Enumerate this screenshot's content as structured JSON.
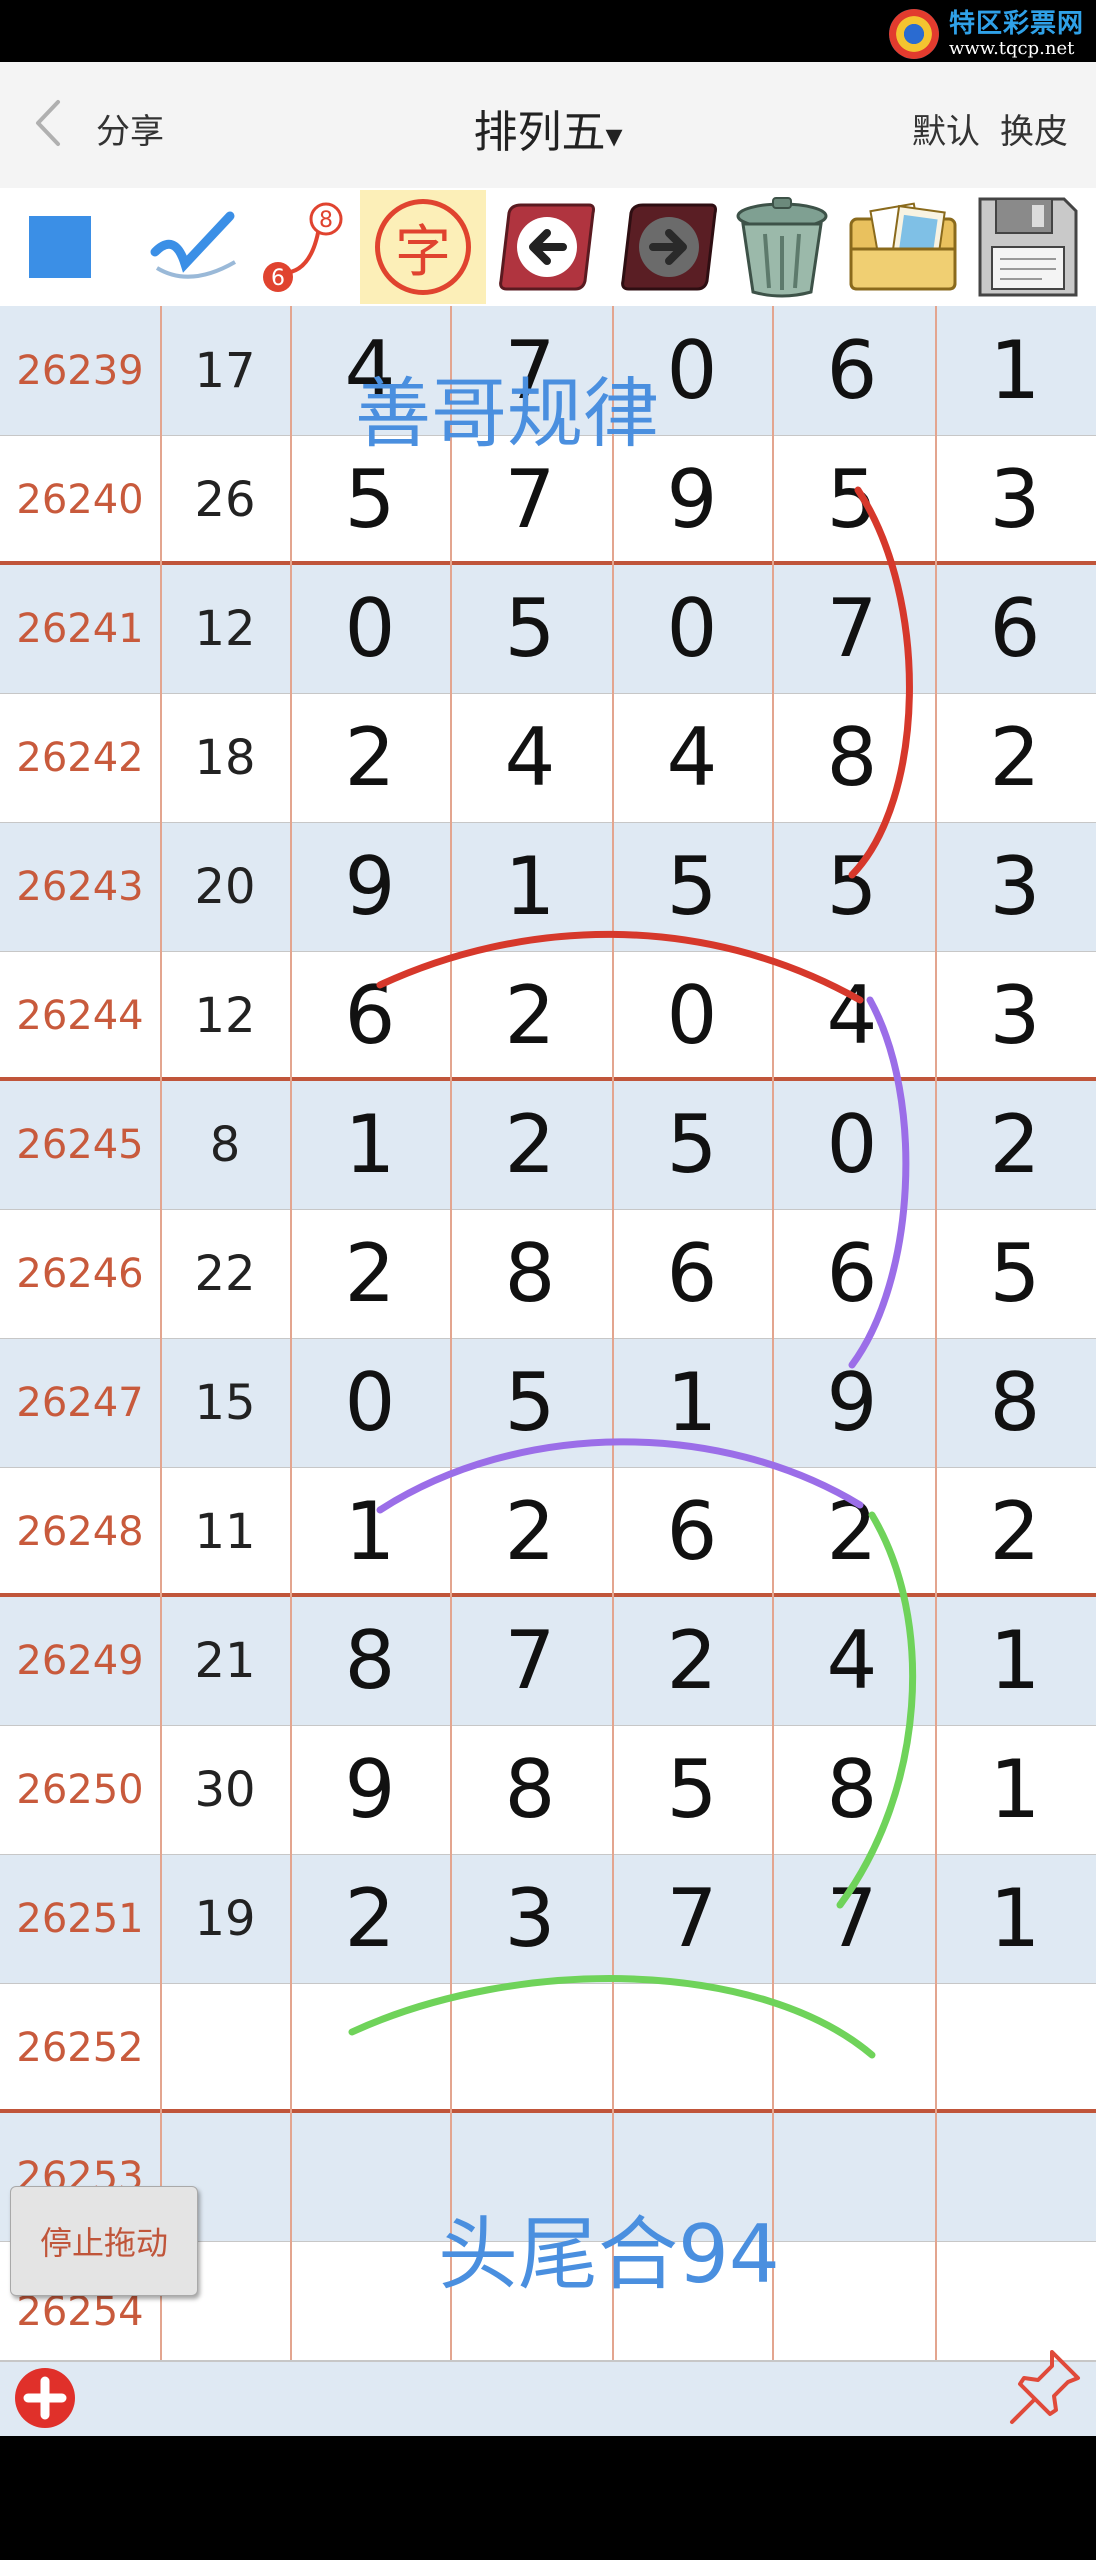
{
  "watermark": {
    "title": "特区彩票网",
    "url": "www.tqcp.net"
  },
  "header": {
    "back_icon": "chevron-left-icon",
    "share": "分享",
    "title": "排列五",
    "title_caret": "▾",
    "default_btn": "默认",
    "skin_btn": "换皮"
  },
  "toolbar": {
    "tools": [
      {
        "name": "color-square-icon",
        "color": "#3b8fe6"
      },
      {
        "name": "pen-check-icon",
        "color": "#3b8fe6"
      },
      {
        "name": "line-6-8-icon",
        "digits": [
          "8",
          "6"
        ],
        "color": "#e0432f"
      },
      {
        "name": "text-zi-icon",
        "label": "字",
        "color": "#e0432f"
      },
      {
        "name": "undo-arrow-icon"
      },
      {
        "name": "redo-arrow-icon"
      },
      {
        "name": "trash-icon"
      },
      {
        "name": "photos-icon"
      },
      {
        "name": "save-floppy-icon"
      }
    ]
  },
  "table": {
    "rows": [
      {
        "issue": "26239",
        "sum": "17",
        "digits": [
          "4",
          "7",
          "0",
          "6",
          "1"
        ]
      },
      {
        "issue": "26240",
        "sum": "26",
        "digits": [
          "5",
          "7",
          "9",
          "5",
          "3"
        ]
      },
      {
        "issue": "26241",
        "sum": "12",
        "digits": [
          "0",
          "5",
          "0",
          "7",
          "6"
        ]
      },
      {
        "issue": "26242",
        "sum": "18",
        "digits": [
          "2",
          "4",
          "4",
          "8",
          "2"
        ]
      },
      {
        "issue": "26243",
        "sum": "20",
        "digits": [
          "9",
          "1",
          "5",
          "5",
          "3"
        ]
      },
      {
        "issue": "26244",
        "sum": "12",
        "digits": [
          "6",
          "2",
          "0",
          "4",
          "3"
        ]
      },
      {
        "issue": "26245",
        "sum": "8",
        "digits": [
          "1",
          "2",
          "5",
          "0",
          "2"
        ]
      },
      {
        "issue": "26246",
        "sum": "22",
        "digits": [
          "2",
          "8",
          "6",
          "6",
          "5"
        ]
      },
      {
        "issue": "26247",
        "sum": "15",
        "digits": [
          "0",
          "5",
          "1",
          "9",
          "8"
        ]
      },
      {
        "issue": "26248",
        "sum": "11",
        "digits": [
          "1",
          "2",
          "6",
          "2",
          "2"
        ]
      },
      {
        "issue": "26249",
        "sum": "21",
        "digits": [
          "8",
          "7",
          "2",
          "4",
          "1"
        ]
      },
      {
        "issue": "26250",
        "sum": "30",
        "digits": [
          "9",
          "8",
          "5",
          "8",
          "1"
        ]
      },
      {
        "issue": "26251",
        "sum": "19",
        "digits": [
          "2",
          "3",
          "7",
          "7",
          "1"
        ]
      },
      {
        "issue": "26252",
        "sum": "",
        "digits": [
          "",
          "",
          "",
          "",
          ""
        ]
      },
      {
        "issue": "26253",
        "sum": "",
        "digits": [
          "",
          "",
          "",
          "",
          ""
        ]
      },
      {
        "issue": "26254",
        "sum": "",
        "digits": [
          "",
          "",
          "",
          "",
          ""
        ]
      }
    ]
  },
  "annotations": {
    "label_top": "善哥规律",
    "label_bottom": "头尾合94",
    "stroke_colors": {
      "red": "#d6382b",
      "purple": "#9b6ee8",
      "green": "#6fd35a"
    }
  },
  "controls": {
    "stop_drag": "停止拖动",
    "add_icon": "plus-circle-icon",
    "pin_icon": "pushpin-icon"
  },
  "colors": {
    "row_alt": "#dfe9f3",
    "row_white": "#ffffff",
    "issue_text": "#c85a3c",
    "group_line": "#c0553a",
    "annotation_text": "#4a8fdf"
  }
}
